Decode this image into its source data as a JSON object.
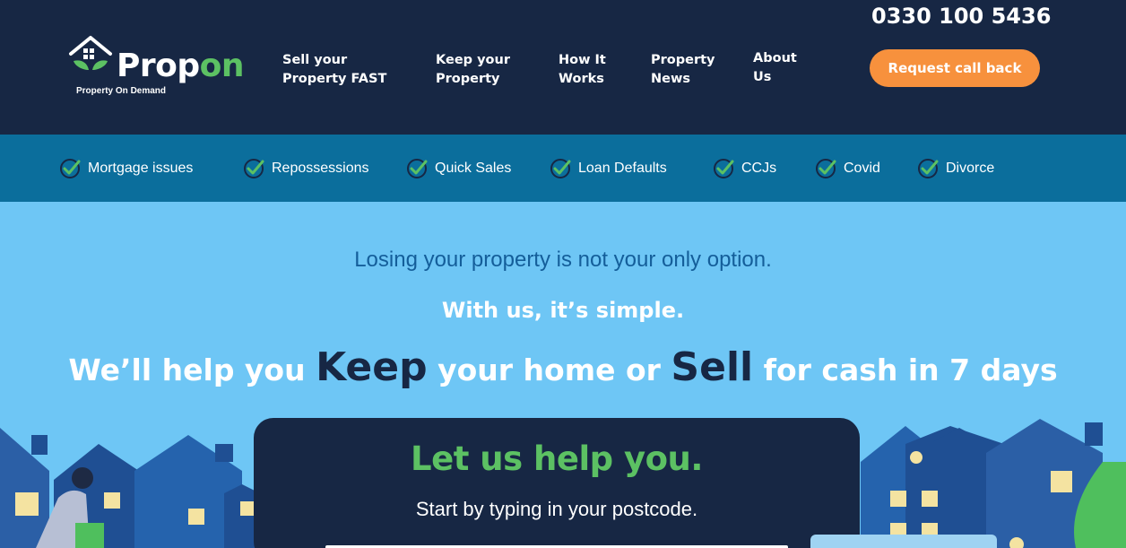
{
  "header": {
    "logo_word_a": "Prop",
    "logo_word_b": "on",
    "logo_tagline": "Property On Demand",
    "phone": "0330 100 5436",
    "callback_label": "Request call back",
    "nav": [
      {
        "label": "Sell your\nProperty FAST"
      },
      {
        "label": "Keep your\nProperty"
      },
      {
        "label": "How It\nWorks"
      },
      {
        "label": "Property\nNews"
      },
      {
        "label": "About\nUs"
      }
    ]
  },
  "tags": [
    {
      "label": "Mortgage issues",
      "icon": "check-circle-icon"
    },
    {
      "label": "Repossessions",
      "icon": "check-circle-icon"
    },
    {
      "label": "Quick Sales",
      "icon": "check-circle-icon"
    },
    {
      "label": "Loan Defaults",
      "icon": "check-circle-icon"
    },
    {
      "label": "CCJs",
      "icon": "check-circle-icon"
    },
    {
      "label": "Covid",
      "icon": "check-circle-icon"
    },
    {
      "label": "Divorce",
      "icon": "check-circle-icon"
    }
  ],
  "hero": {
    "line1": "Losing your property is not your only option.",
    "line2": "With us, it’s simple.",
    "line3_a": "We’ll help you ",
    "line3_keep": "Keep",
    "line3_b": " your home or ",
    "line3_sell": "Sell",
    "line3_c": " for cash in 7 days"
  },
  "card": {
    "title": "Let us help you.",
    "subtitle": "Start by typing in your postcode.",
    "postcode_value": ""
  },
  "colors": {
    "navy": "#172744",
    "tagbar": "#0b6e9c",
    "sky": "#6ec6f5",
    "accent_orange": "#f7913d",
    "brand_green": "#5cc163"
  }
}
